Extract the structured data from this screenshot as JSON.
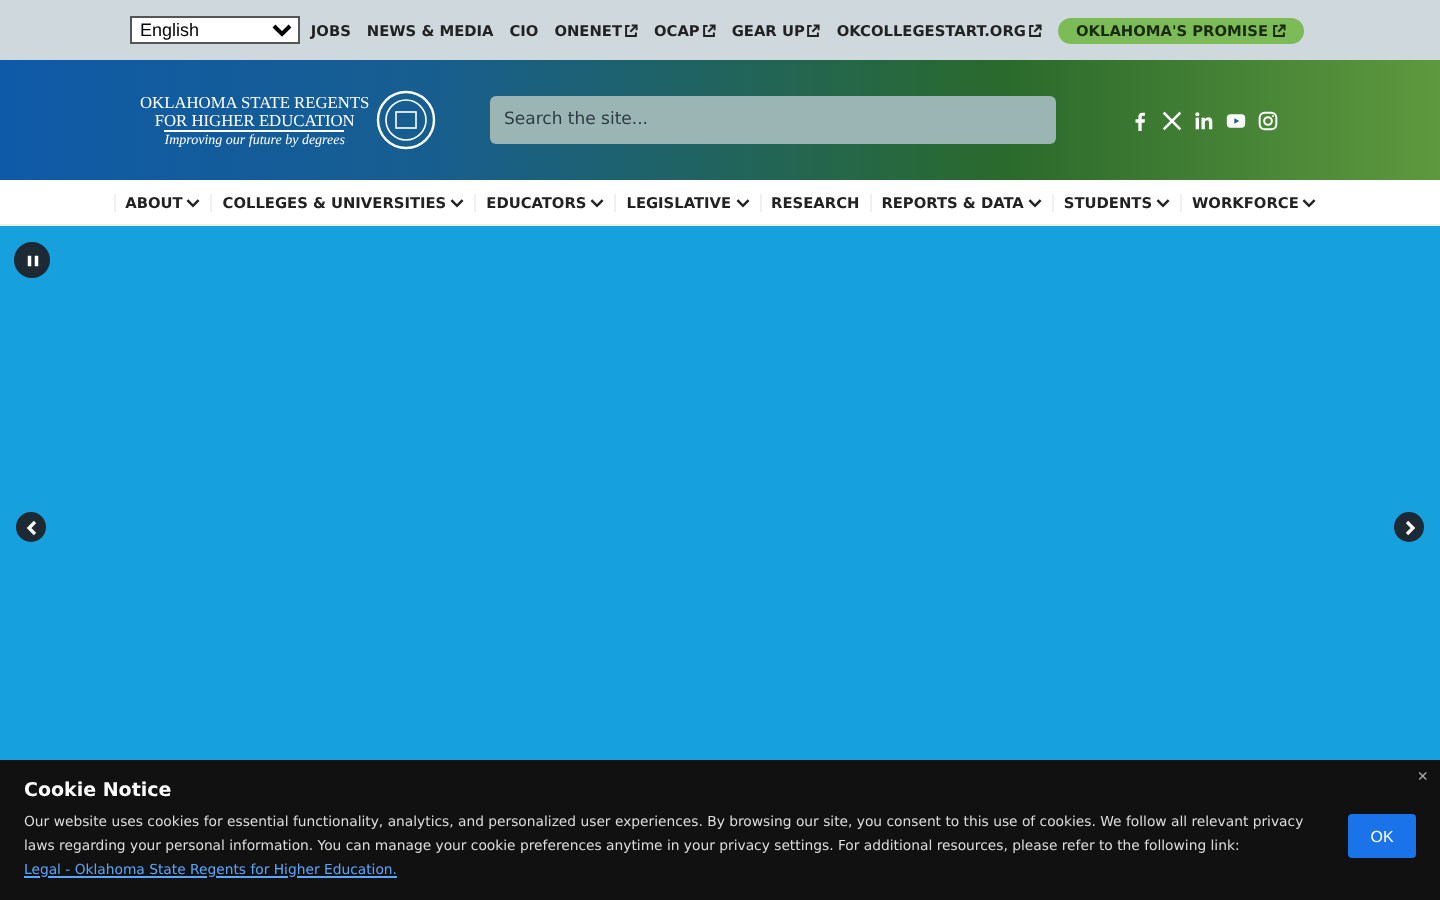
{
  "language_select": {
    "value": "English"
  },
  "top_links": [
    {
      "label": "JOBS",
      "external": false
    },
    {
      "label": "NEWS & MEDIA",
      "external": false
    },
    {
      "label": "CIO",
      "external": false
    },
    {
      "label": "ONENET",
      "external": true
    },
    {
      "label": "OCAP",
      "external": true
    },
    {
      "label": "GEAR UP",
      "external": true
    },
    {
      "label": "OKCOLLEGESTART.ORG",
      "external": true
    }
  ],
  "promise_button": {
    "label": "OKLAHOMA'S PROMISE",
    "external": true
  },
  "logo": {
    "line_1": "OKLAHOMA STATE REGENTS",
    "line_2": "FOR HIGHER EDUCATION",
    "tagline": "Improving our future by degrees"
  },
  "search": {
    "placeholder": "Search the site..."
  },
  "social": [
    {
      "kind": "facebook"
    },
    {
      "kind": "x"
    },
    {
      "kind": "linkedin"
    },
    {
      "kind": "youtube"
    },
    {
      "kind": "instagram"
    }
  ],
  "nav": [
    {
      "label": "ABOUT",
      "dropdown": true
    },
    {
      "label": "COLLEGES & UNIVERSITIES",
      "dropdown": true
    },
    {
      "label": "EDUCATORS",
      "dropdown": true
    },
    {
      "label": "LEGISLATIVE",
      "dropdown": true
    },
    {
      "label": "RESEARCH",
      "dropdown": false
    },
    {
      "label": "REPORTS & DATA",
      "dropdown": true
    },
    {
      "label": "STUDENTS",
      "dropdown": true
    },
    {
      "label": "WORKFORCE",
      "dropdown": true
    }
  ],
  "cookie_notice": {
    "title": "Cookie Notice",
    "text": "Our website uses cookies for essential functionality, analytics, and personalized user experiences. By browsing our site, you consent to this use of cookies. We follow all relevant privacy laws regarding your personal information. You can manage your cookie preferences anytime in your privacy settings. For additional resources, please refer to the following link: ",
    "link": "Legal - Oklahoma State Regents for Higher Education.",
    "close": "×",
    "button": "OK"
  }
}
